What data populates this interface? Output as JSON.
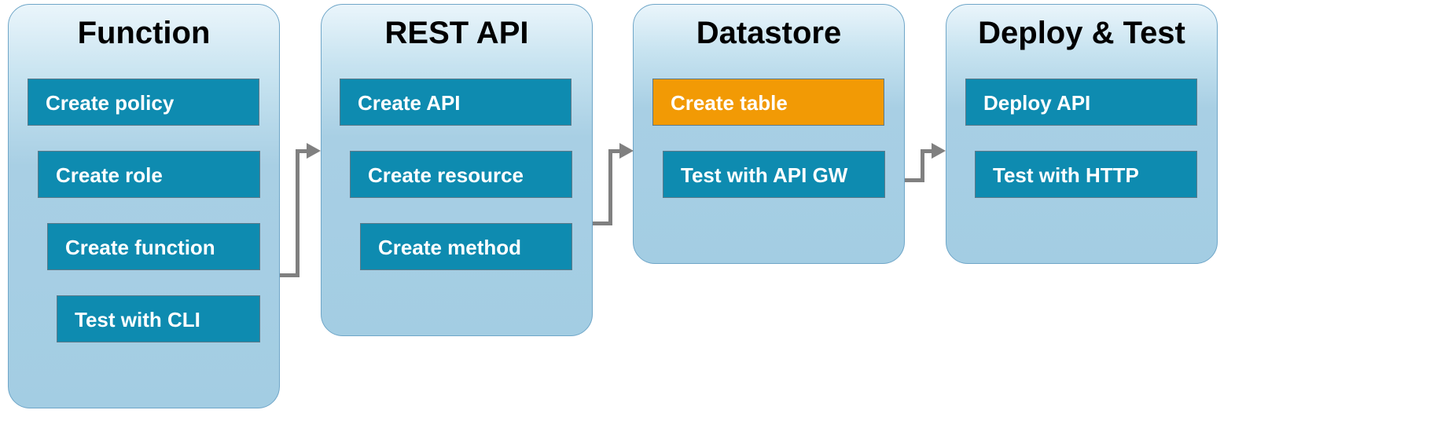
{
  "cards": {
    "function": {
      "title": "Function",
      "steps": {
        "policy": "Create policy",
        "role": "Create role",
        "func": "Create function",
        "testcli": "Test with CLI"
      }
    },
    "restapi": {
      "title": "REST API",
      "steps": {
        "api": "Create API",
        "resource": "Create resource",
        "method": "Create method"
      }
    },
    "datastore": {
      "title": "Datastore",
      "steps": {
        "table": "Create table",
        "testgw": "Test with API GW"
      }
    },
    "deploy": {
      "title": "Deploy & Test",
      "steps": {
        "deploy": "Deploy API",
        "testhttp": "Test with HTTP"
      }
    }
  },
  "colors": {
    "step_normal": "#0e8bb0",
    "step_highlight": "#f29a05",
    "card_border": "#6fa6c8",
    "arrow": "#808080"
  }
}
